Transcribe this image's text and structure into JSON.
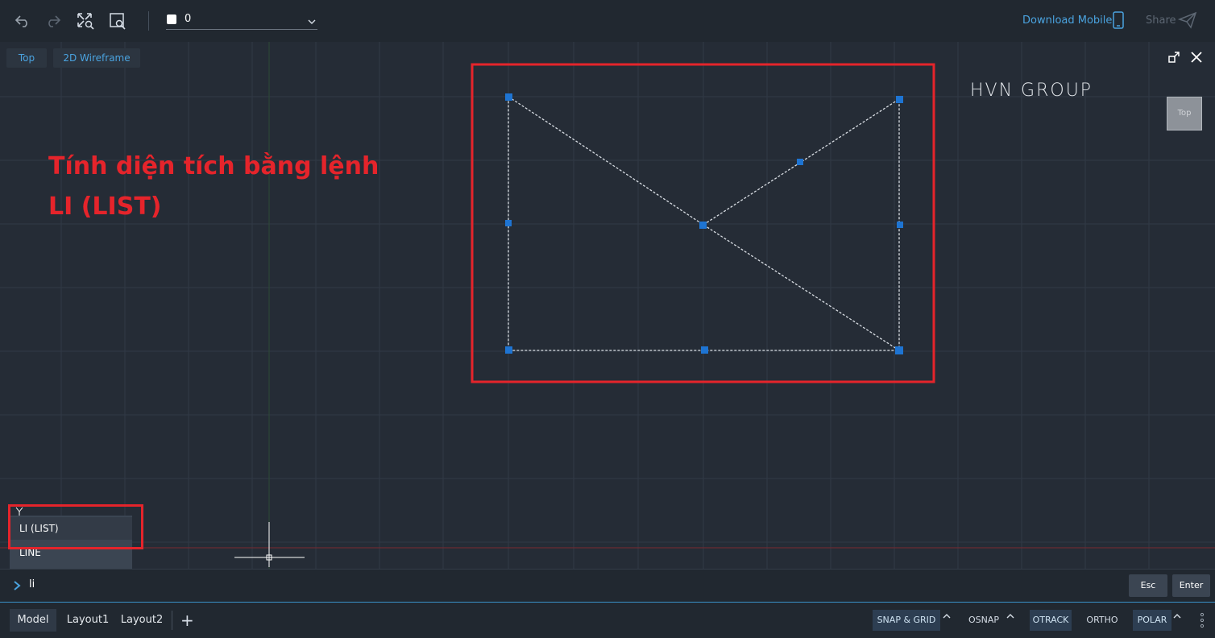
{
  "toolbar": {
    "layer_value": "0",
    "download_mobile": "Download Mobile",
    "share": "Share"
  },
  "viewport": {
    "view_label": "Top",
    "visual_style": "2D Wireframe",
    "viewcube_label": "Top",
    "watermark": "HVN GROUP"
  },
  "annotation": {
    "line1": "Tính diện tích bằng lệnh",
    "line2": "LI (LIST)"
  },
  "autocomplete": {
    "items": [
      "LI (LIST)",
      "LINE"
    ],
    "selected_index": 0
  },
  "command": {
    "input_value": "li",
    "esc_label": "Esc",
    "enter_label": "Enter"
  },
  "status": {
    "tabs": [
      "Model",
      "Layout1",
      "Layout2"
    ],
    "active_tab": "Model",
    "snap_grid": "SNAP & GRID",
    "osnap": "OSNAP",
    "otrack": "OTRACK",
    "ortho": "ORTHO",
    "polar": "POLAR"
  },
  "colors": {
    "accent": "#4aa3df",
    "highlight_red": "#e5242b",
    "grip_blue": "#1e74d2"
  }
}
